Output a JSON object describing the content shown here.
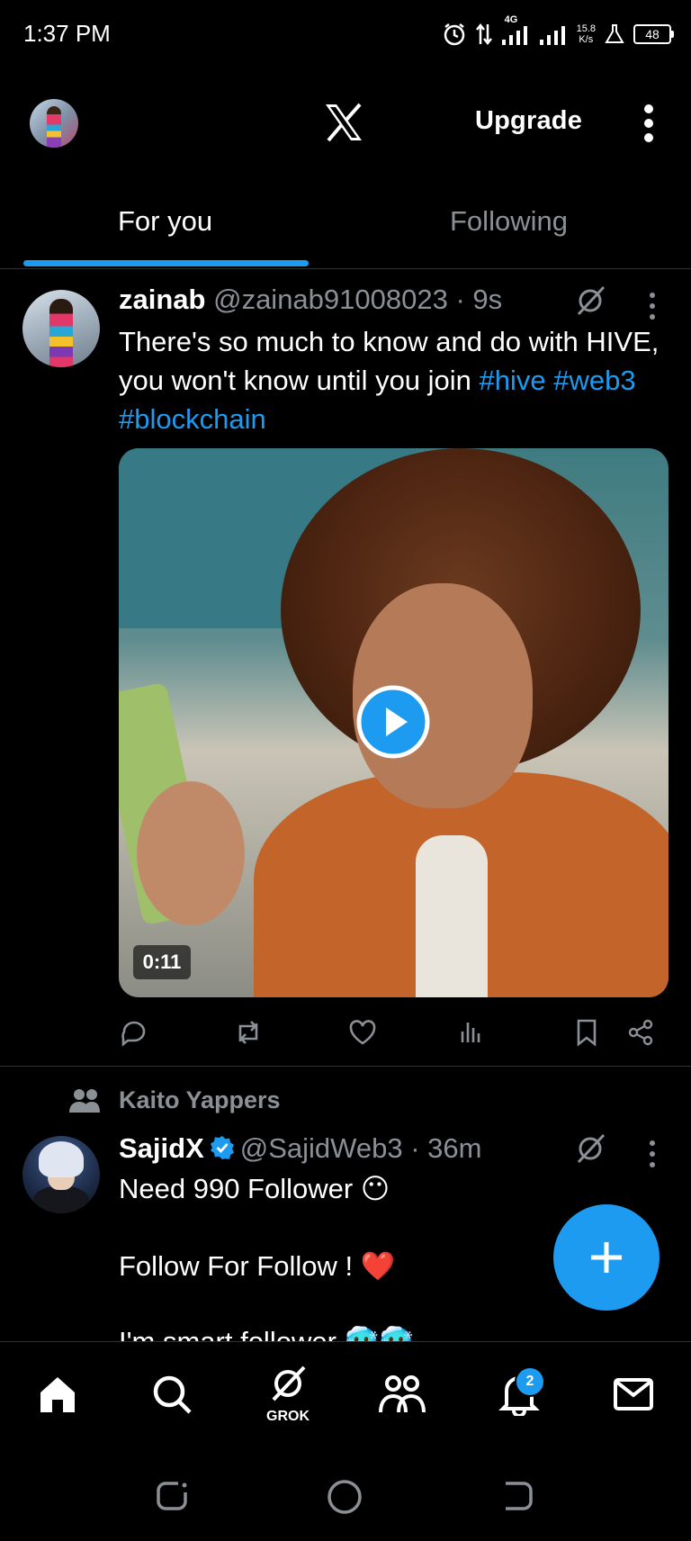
{
  "status_bar": {
    "time": "1:37 PM",
    "network_type": "4G",
    "net_speed_value": "15.8",
    "net_speed_unit": "K/s",
    "battery": "48"
  },
  "header": {
    "logo_icon": "x-logo-icon",
    "upgrade_label": "Upgrade"
  },
  "tabs": [
    {
      "label": "For you",
      "active": true
    },
    {
      "label": "Following",
      "active": false
    }
  ],
  "tweet1": {
    "name": "zainab",
    "handle": "@zainab91008023",
    "time": "9s",
    "text_plain": "There's so much to know and do with HIVE, you won't know until you join ",
    "tags": [
      "#hive",
      "#web3",
      "#blockchain"
    ],
    "video_duration": "0:11"
  },
  "tweet2": {
    "context": "Kaito Yappers",
    "name": "SajidX",
    "handle": "@SajidWeb3",
    "time": "36m",
    "line1": "Need 990 Follower 😶",
    "line2": "Follow For Follow ! ❤️",
    "line3": "I'm smart follower 🥶🥶"
  },
  "bottom_nav": {
    "grok_label": "GROK",
    "notification_count": "2"
  },
  "colors": {
    "accent": "#1d9bf0",
    "background": "#000000",
    "secondary_text": "#8b9096"
  }
}
